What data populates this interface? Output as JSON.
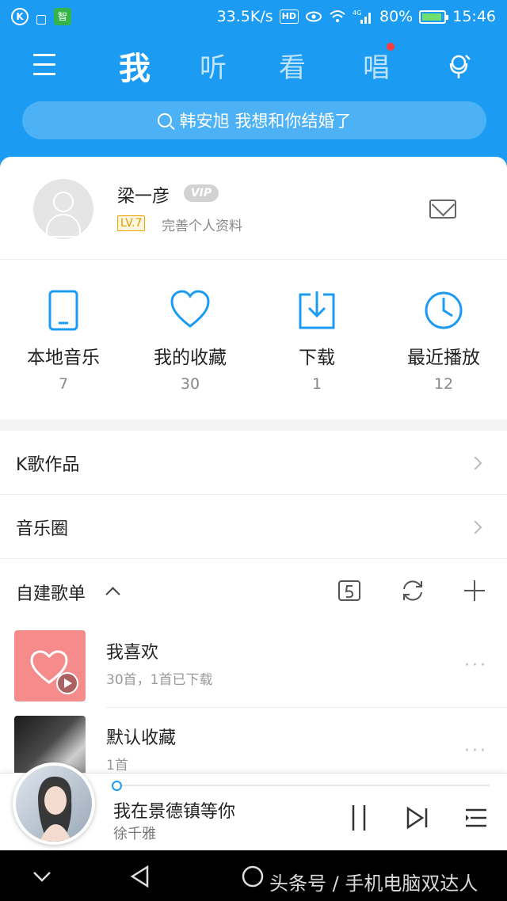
{
  "status_bar": {
    "speed": "33.5K/s",
    "hd": "HD",
    "network": "4G",
    "battery": "80%",
    "time": "15:46",
    "left_icons": [
      "k-app-icon",
      "notification-icon",
      "wechat-app-icon"
    ],
    "app_badge": "智"
  },
  "nav": {
    "tabs": [
      "我",
      "听",
      "看",
      "唱"
    ],
    "active_tab": "我",
    "sing_has_notification": true
  },
  "search": {
    "placeholder": "韩安旭 我想和你结婚了"
  },
  "profile": {
    "name": "梁一彦",
    "vip_badge": "VIP",
    "level": "LV.7",
    "complete_profile": "完善个人资料"
  },
  "quick_actions": [
    {
      "label": "本地音乐",
      "count": "7",
      "icon": "phone-icon"
    },
    {
      "label": "我的收藏",
      "count": "30",
      "icon": "heart-icon"
    },
    {
      "label": "下载",
      "count": "1",
      "icon": "download-icon"
    },
    {
      "label": "最近播放",
      "count": "12",
      "icon": "clock-icon"
    }
  ],
  "menu_rows": [
    {
      "label": "K歌作品"
    },
    {
      "label": "音乐圈"
    }
  ],
  "playlists_header": {
    "label": "自建歌单"
  },
  "playlists": [
    {
      "title": "我喜欢",
      "subtitle": "30首，1首已下载"
    },
    {
      "title": "默认收藏",
      "subtitle": "1首"
    }
  ],
  "now_playing": {
    "song": "我在景德镇等你",
    "singer": "徐千雅",
    "progress": 0.0
  },
  "watermark": "头条号 / 手机电脑双达人",
  "colors": {
    "brand_blue": "#1b9bf2",
    "favorites_pink": "#f58b8b",
    "notification_red": "#ff3b3b"
  }
}
